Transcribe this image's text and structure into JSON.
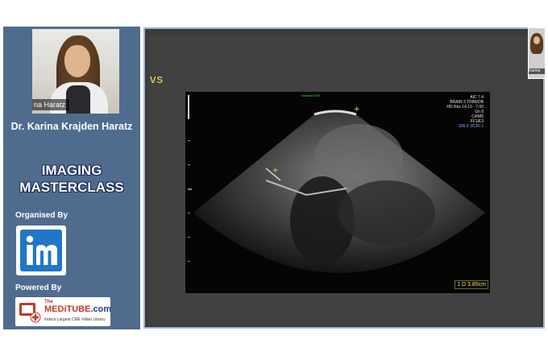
{
  "sidebar": {
    "speaker_video_tag": "na Haratz",
    "speaker_name": "Dr. Karina Krajden Haratz",
    "course_title_line1": "IMAGING",
    "course_title_line2": "MASTERCLASS",
    "organised_label": "Organised By",
    "powered_label": "Powered By",
    "meditube": {
      "the": "The",
      "name_part1": "MEDi",
      "name_part2": "TUBE",
      "name_suffix": ".com",
      "tagline": "India's Largest CME Video Library"
    }
  },
  "shared_screen": {
    "slide_text": "vs",
    "ultrasound": {
      "top_label": "Volusion E10",
      "info_lines": [
        "AIC 7.4",
        "BRAIN 2 TRIM/OB",
        "HD Res 14.10 - 7.00",
        "Gn   8",
        "C4/M5",
        "FF1/E3"
      ],
      "info_accent_line": "SRI II 3/CRI 1",
      "measurement": "1 D 3.85cm"
    }
  },
  "presenter_thumbnail": {
    "name": "Karina"
  },
  "colors": {
    "sidebar_bg": "#4f6c8f",
    "title_outline": "#1b2a55",
    "accent_yellow": "#f0e24a",
    "logo_blue": "#1f77c6",
    "meditube_red": "#c0392b"
  }
}
